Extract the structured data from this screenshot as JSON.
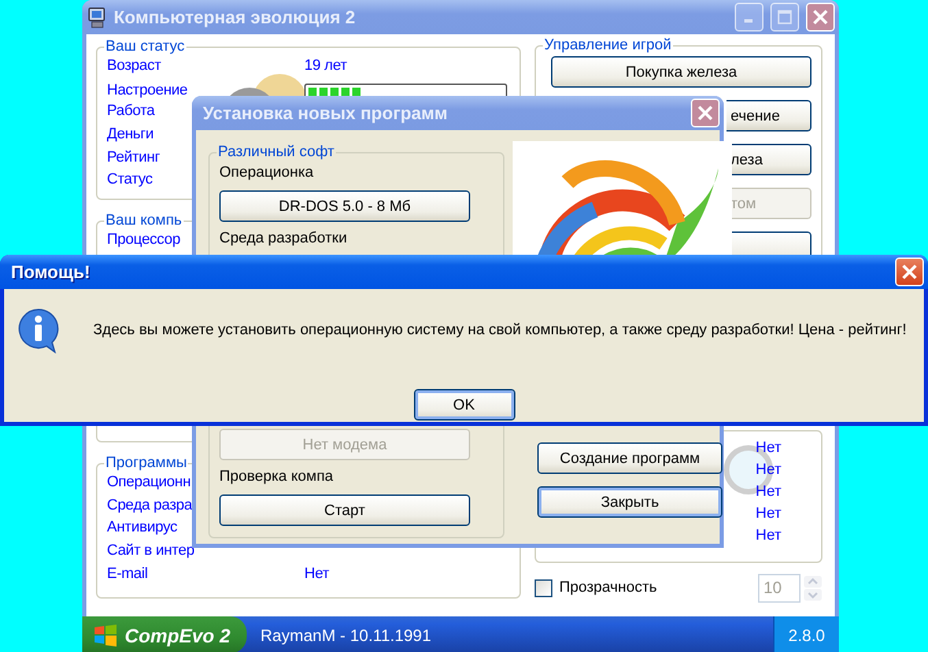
{
  "main_window": {
    "title": "Компьютерная эволюция 2",
    "status_group": {
      "title": "Ваш статус",
      "rows": [
        {
          "label": "Возраст",
          "kind": "text",
          "value": "19 лет"
        },
        {
          "label": "Настроение",
          "kind": "meter",
          "level": 0.27
        },
        {
          "label": "Работа",
          "kind": "text"
        },
        {
          "label": "Деньги",
          "kind": "text"
        },
        {
          "label": "Рейтинг",
          "kind": "text"
        },
        {
          "label": "Статус",
          "kind": "text"
        }
      ]
    },
    "computer_group": {
      "title": "Ваш компь",
      "rows": [
        {
          "label": "Процессор"
        }
      ]
    },
    "programs_group": {
      "title": "Программы",
      "rows": [
        {
          "label": "Операционн"
        },
        {
          "label": "Среда разра"
        },
        {
          "label": "Антивирус"
        },
        {
          "label": "Сайт в интер"
        },
        {
          "label": "E-mail",
          "value": "Нет"
        }
      ]
    },
    "control_group": {
      "title": "Управление игрой",
      "buttons": [
        {
          "label": "Покупка железа",
          "disabled": false,
          "clipped": false
        },
        {
          "label": "ечение",
          "disabled": false,
          "clipped": true
        },
        {
          "label": "леза",
          "disabled": false,
          "clipped": true
        },
        {
          "label": "том",
          "disabled": true,
          "clipped": true
        },
        {
          "disabled": false,
          "clipped": true
        }
      ]
    },
    "stats_values": [
      "Нет",
      "Нет",
      "Нет",
      "Нет",
      "Нет"
    ],
    "transparency": {
      "label": "Прозрачность",
      "checked": false
    },
    "opacity_field": {
      "value": "10",
      "disabled": true
    },
    "taskbar": {
      "start": "CompEvo 2",
      "user": "RaymanM - 10.11.1991",
      "version": "2.8.0"
    }
  },
  "install_dialog": {
    "title": "Установка новых программ",
    "group_title": "Различный софт",
    "items_top": [
      {
        "kind": "label",
        "text": "Операционка"
      },
      {
        "kind": "button",
        "text": "DR-DOS 5.0 - 8 Мб",
        "disabled": false
      },
      {
        "kind": "label",
        "text": "Среда разработки"
      }
    ],
    "items_bottom": [
      {
        "kind": "button",
        "text": "Нет модема",
        "disabled": true
      },
      {
        "kind": "label",
        "text": "Проверка компа"
      },
      {
        "kind": "button",
        "text": "Старт",
        "disabled": false
      }
    ],
    "buttons": [
      {
        "label": "Создание программ",
        "default": false
      },
      {
        "label": "Закрыть",
        "default": true
      }
    ]
  },
  "message_box": {
    "title": "Помощь!",
    "text": "Здесь вы можете установить операционную систему на свой компьютер, а также среду разработки! Цена - рейтинг!",
    "button": "OK"
  }
}
